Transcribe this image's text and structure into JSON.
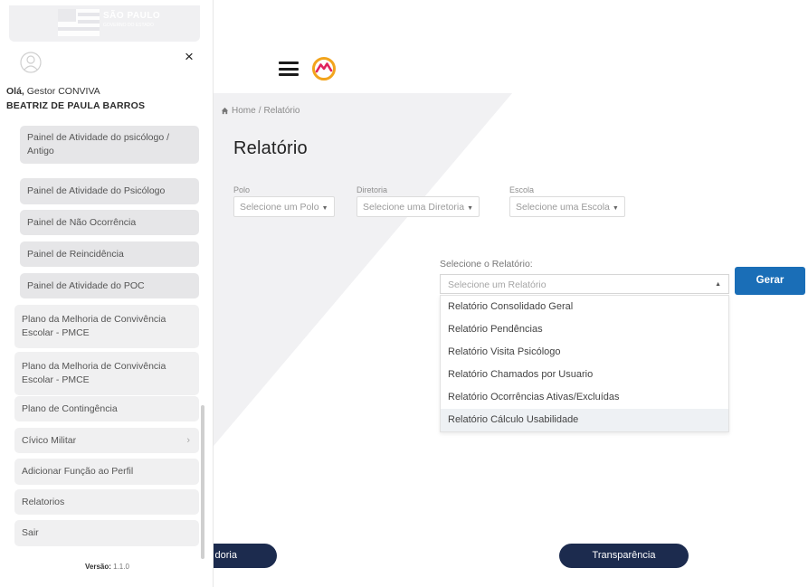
{
  "colors": {
    "accent": "#1a6eb7",
    "navy_pill": "#1c2b4e",
    "grey_band": "#f1f1f3"
  },
  "sidebar": {
    "logo_text": "SÃO PAULO",
    "logo_subtitle": "GOVERNO DO ESTADO",
    "greeting_prefix": "Olá,",
    "greeting_role": " Gestor CONVIVA",
    "user_name": "BEATRIZ DE PAULA BARROS",
    "close_icon": "×",
    "items": [
      {
        "label": "Painel de Atividade do psicólogo / Antigo",
        "level": "sub"
      },
      {
        "label": "Painel de Atividade do Psicólogo",
        "level": "sub"
      },
      {
        "label": "Painel de Não Ocorrência",
        "level": "sub"
      },
      {
        "label": "Painel de Reincidência",
        "level": "sub"
      },
      {
        "label": "Painel de Atividade do POC",
        "level": "sub"
      },
      {
        "label": "Plano da Melhoria de Convivência Escolar - PMCE",
        "level": "top"
      },
      {
        "label": "Plano da Melhoria de Convivência Escolar - PMCE",
        "level": "top"
      },
      {
        "label": "Plano de Contingência",
        "level": "top"
      },
      {
        "label": "Cívico Militar",
        "level": "top",
        "chevron": "›"
      },
      {
        "label": "Adicionar Função ao Perfil",
        "level": "top"
      },
      {
        "label": "Relatorios",
        "level": "top"
      },
      {
        "label": "Sair",
        "level": "top"
      }
    ],
    "version_label": "Versão:",
    "version_value": " 1.1.0"
  },
  "breadcrumb": {
    "home": "Home",
    "separator": " / ",
    "current": "Relatório"
  },
  "page_title": "Relatório",
  "filters": {
    "polo": {
      "label": "Polo",
      "placeholder": "Selecione um Polo"
    },
    "diretoria": {
      "label": "Diretoria",
      "placeholder": "Selecione uma Diretoria"
    },
    "escola": {
      "label": "Escola",
      "placeholder": "Selecione uma Escola"
    }
  },
  "report": {
    "label": "Selecione o Relatório:",
    "placeholder": "Selecione um Relatório",
    "generate_label": "Gerar",
    "options": [
      "Relatório Consolidado Geral",
      "Relatório Pendências",
      "Relatório Visita Psicólogo",
      "Relatório Chamados por Usuario",
      "Relatório Ocorrências Ativas/Excluídas",
      "Relatório Cálculo Usabilidade"
    ],
    "highlighted_index": 5
  },
  "footer": {
    "left_button": "doria",
    "right_button": "Transparência"
  }
}
